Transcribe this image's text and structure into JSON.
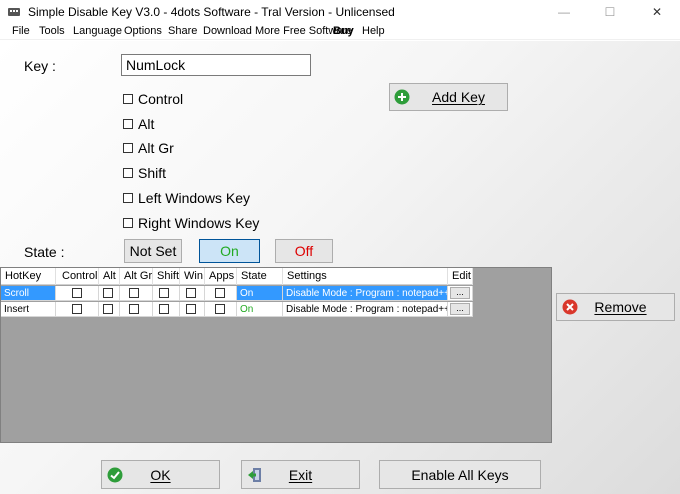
{
  "window": {
    "title": "Simple Disable Key V3.0 - 4dots Software - Tral Version - Unlicensed",
    "minimize": "—",
    "maximize": "☐",
    "close": "✕"
  },
  "menu": [
    "File",
    "Tools",
    "Language",
    "Options",
    "Share",
    "Download More Free Software",
    "Buy",
    "Help"
  ],
  "form": {
    "key_label": "Key :",
    "key_value": "NumLock",
    "state_label": "State :",
    "modifiers": [
      "Control",
      "Alt",
      "Alt Gr",
      "Shift",
      "Left Windows Key",
      "Right Windows Key"
    ],
    "add_key": "Add Key",
    "state_not_set": "Not Set",
    "state_on": "On",
    "state_off": "Off"
  },
  "grid": {
    "headers": [
      "HotKey",
      "Control",
      "Alt",
      "Alt Gr",
      "Shift",
      "Win",
      "Apps",
      "State",
      "Settings",
      "Edit"
    ],
    "rows": [
      {
        "hotkey": "Scroll",
        "state": "On",
        "settings": "Disable Mode : Program : notepad++",
        "edit": "...",
        "selected": true
      },
      {
        "hotkey": "Insert",
        "state": "On",
        "settings": "Disable Mode : Program : notepad++",
        "edit": "...",
        "selected": false
      }
    ]
  },
  "buttons": {
    "remove": "Remove",
    "ok": "OK",
    "exit": "Exit",
    "enable_all": "Enable All Keys"
  },
  "colors": {
    "on_green": "#22aa22",
    "off_red": "#dd0000",
    "selection_blue": "#3399ff",
    "add_icon_green": "#2e9d3a",
    "remove_icon_red": "#d9372b"
  },
  "icons": {
    "add": "plus-circle-icon",
    "remove": "x-circle-icon",
    "ok": "check-circle-icon",
    "exit": "exit-door-icon"
  }
}
